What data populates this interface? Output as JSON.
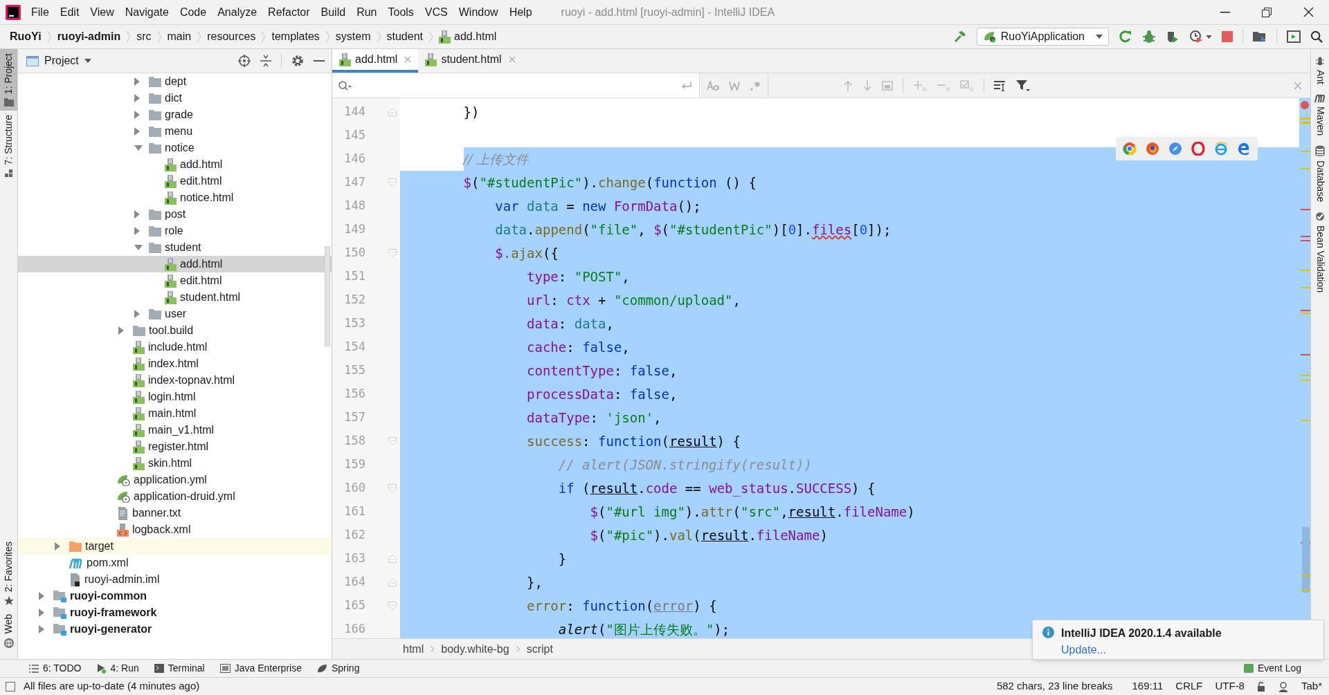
{
  "window": {
    "title": "ruoyi - add.html [ruoyi-admin] - IntelliJ IDEA"
  },
  "main_menu": [
    "File",
    "Edit",
    "View",
    "Navigate",
    "Code",
    "Analyze",
    "Refactor",
    "Build",
    "Run",
    "Tools",
    "VCS",
    "Window",
    "Help"
  ],
  "nav_path": [
    {
      "label": "RuoYi",
      "kind": "project"
    },
    {
      "label": "ruoyi-admin",
      "kind": "module"
    },
    {
      "label": "src",
      "kind": "folder"
    },
    {
      "label": "main",
      "kind": "folder"
    },
    {
      "label": "resources",
      "kind": "folder"
    },
    {
      "label": "templates",
      "kind": "folder"
    },
    {
      "label": "system",
      "kind": "folder"
    },
    {
      "label": "student",
      "kind": "folder"
    },
    {
      "label": "add.html",
      "kind": "html"
    }
  ],
  "run_config": "RuoYiApplication",
  "left_strip": [
    {
      "label": "1: Project",
      "kind": "project",
      "selected": true
    },
    {
      "label": "7: Structure",
      "kind": "structure",
      "selected": false
    },
    {
      "label": "2: Favorites",
      "kind": "favorites",
      "selected": false
    },
    {
      "label": "Web",
      "kind": "web",
      "selected": false
    }
  ],
  "project_panel": {
    "title": "Project"
  },
  "tree": [
    {
      "kind": "group",
      "children": [
        {
          "kind": "group",
          "children": [
            {
              "kind": "group",
              "children": [
                {
                  "kind": "group",
                  "children": [
                    {
                      "kind": "group",
                      "children": [
                        {
                          "kind": "group",
                          "children": [
                            {
                              "label": "dept",
                              "kind": "folder",
                              "expanded": false,
                              "selected": false
                            },
                            {
                              "label": "dict",
                              "kind": "folder",
                              "expanded": false,
                              "selected": false
                            },
                            {
                              "label": "grade",
                              "kind": "folder",
                              "expanded": false,
                              "selected": false
                            },
                            {
                              "label": "menu",
                              "kind": "folder",
                              "expanded": false,
                              "selected": false
                            },
                            {
                              "label": "notice",
                              "kind": "folder",
                              "expanded": true,
                              "selected": false,
                              "children": [
                                {
                                  "label": "add.html",
                                  "kind": "html",
                                  "selected": false
                                },
                                {
                                  "label": "edit.html",
                                  "kind": "html",
                                  "selected": false
                                },
                                {
                                  "label": "notice.html",
                                  "kind": "html",
                                  "selected": false
                                }
                              ]
                            },
                            {
                              "label": "post",
                              "kind": "folder",
                              "expanded": false,
                              "selected": false
                            },
                            {
                              "label": "role",
                              "kind": "folder",
                              "expanded": false,
                              "selected": false
                            },
                            {
                              "label": "student",
                              "kind": "folder",
                              "expanded": true,
                              "selected": false,
                              "children": [
                                {
                                  "label": "add.html",
                                  "kind": "html",
                                  "selected": true
                                },
                                {
                                  "label": "edit.html",
                                  "kind": "html",
                                  "selected": false
                                },
                                {
                                  "label": "student.html",
                                  "kind": "html",
                                  "selected": false
                                }
                              ]
                            },
                            {
                              "label": "user",
                              "kind": "folder",
                              "expanded": false,
                              "selected": false
                            }
                          ]
                        },
                        {
                          "label": "tool.build",
                          "kind": "folder",
                          "expanded": false,
                          "selected": false
                        },
                        {
                          "label": "include.html",
                          "kind": "html",
                          "selected": false
                        },
                        {
                          "label": "index.html",
                          "kind": "html",
                          "selected": false
                        },
                        {
                          "label": "index-topnav.html",
                          "kind": "html",
                          "selected": false
                        },
                        {
                          "label": "login.html",
                          "kind": "html",
                          "selected": false
                        },
                        {
                          "label": "main.html",
                          "kind": "html",
                          "selected": false
                        },
                        {
                          "label": "main_v1.html",
                          "kind": "html",
                          "selected": false
                        },
                        {
                          "label": "register.html",
                          "kind": "html",
                          "selected": false
                        },
                        {
                          "label": "skin.html",
                          "kind": "html",
                          "selected": false
                        }
                      ]
                    },
                    {
                      "label": "application.yml",
                      "kind": "yml",
                      "selected": false
                    },
                    {
                      "label": "application-druid.yml",
                      "kind": "yml",
                      "selected": false
                    },
                    {
                      "label": "banner.txt",
                      "kind": "txt",
                      "selected": false
                    },
                    {
                      "label": "logback.xml",
                      "kind": "xml",
                      "selected": false
                    }
                  ]
                }
              ]
            }
          ]
        },
        {
          "label": "target",
          "kind": "excluded",
          "expanded": false,
          "selected": false
        },
        {
          "label": "pom.xml",
          "kind": "maven",
          "selected": false
        },
        {
          "label": "ruoyi-admin.iml",
          "kind": "iml",
          "selected": false
        }
      ]
    },
    {
      "label": "ruoyi-common",
      "kind": "module",
      "expanded": false,
      "selected": false
    },
    {
      "label": "ruoyi-framework",
      "kind": "module",
      "expanded": false,
      "selected": false
    },
    {
      "label": "ruoyi-generator",
      "kind": "module",
      "expanded": false,
      "selected": false
    }
  ],
  "editor_tabs": [
    {
      "label": "add.html",
      "selected": true
    },
    {
      "label": "student.html",
      "selected": false
    }
  ],
  "code_lines": [
    {
      "number": "144",
      "selected": false,
      "fold_start": false,
      "fold_end": true,
      "tokens": [
        {
          "kind": "plain",
          "text": "        })"
        }
      ]
    },
    {
      "number": "145",
      "selected": false,
      "fold_start": false,
      "fold_end": false
    },
    {
      "number": "146",
      "selected": true,
      "fold_start": false,
      "fold_end": false,
      "tokens": [
        {
          "kind": "comment",
          "text": "        // 上传文件"
        }
      ]
    },
    {
      "number": "147",
      "selected": true,
      "fold_start": true,
      "fold_end": false,
      "tokens": [
        {
          "kind": "prop",
          "text": "        $"
        },
        {
          "kind": "plain",
          "text": "("
        },
        {
          "kind": "string",
          "text": "\"#studentPic\""
        },
        {
          "kind": "plain",
          "text": ")."
        },
        {
          "kind": "method",
          "text": "change"
        },
        {
          "kind": "plain",
          "text": "("
        },
        {
          "kind": "keyword",
          "text": "function"
        },
        {
          "kind": "plain",
          "text": " () {"
        }
      ]
    },
    {
      "number": "148",
      "selected": true,
      "fold_start": false,
      "fold_end": false,
      "tokens": [
        {
          "kind": "keyword",
          "text": "            var"
        },
        {
          "kind": "local",
          "text": " data"
        },
        {
          "kind": "plain",
          "text": " = "
        },
        {
          "kind": "keyword",
          "text": "new"
        },
        {
          "kind": "prop",
          "text": " FormData"
        },
        {
          "kind": "plain",
          "text": "();"
        }
      ]
    },
    {
      "number": "149",
      "selected": true,
      "fold_start": false,
      "fold_end": false,
      "tokens": [
        {
          "kind": "local",
          "text": "            data"
        },
        {
          "kind": "plain",
          "text": "."
        },
        {
          "kind": "method",
          "text": "append"
        },
        {
          "kind": "plain",
          "text": "("
        },
        {
          "kind": "string",
          "text": "\"file\""
        },
        {
          "kind": "plain",
          "text": ", "
        },
        {
          "kind": "prop",
          "text": "$"
        },
        {
          "kind": "plain",
          "text": "("
        },
        {
          "kind": "string",
          "text": "\"#studentPic\""
        },
        {
          "kind": "plain",
          "text": ")["
        },
        {
          "kind": "number",
          "text": "0"
        },
        {
          "kind": "plain",
          "text": "]."
        },
        {
          "kind": "warn",
          "text": "files"
        },
        {
          "kind": "plain",
          "text": "["
        },
        {
          "kind": "number",
          "text": "0"
        },
        {
          "kind": "plain",
          "text": "]);"
        }
      ]
    },
    {
      "number": "150",
      "selected": true,
      "fold_start": true,
      "fold_end": false,
      "tokens": [
        {
          "kind": "prop",
          "text": "            $"
        },
        {
          "kind": "method",
          "text": ".ajax"
        },
        {
          "kind": "plain",
          "text": "({"
        }
      ]
    },
    {
      "number": "151",
      "selected": true,
      "fold_start": false,
      "fold_end": false,
      "tokens": [
        {
          "kind": "prop",
          "text": "                type"
        },
        {
          "kind": "plain",
          "text": ": "
        },
        {
          "kind": "string",
          "text": "\"POST\""
        },
        {
          "kind": "plain",
          "text": ","
        }
      ]
    },
    {
      "number": "152",
      "selected": true,
      "fold_start": false,
      "fold_end": false,
      "tokens": [
        {
          "kind": "prop",
          "text": "                url"
        },
        {
          "kind": "plain",
          "text": ": "
        },
        {
          "kind": "prop",
          "text": "ctx"
        },
        {
          "kind": "plain",
          "text": " + "
        },
        {
          "kind": "string",
          "text": "\"common/upload\""
        },
        {
          "kind": "plain",
          "text": ","
        }
      ]
    },
    {
      "number": "153",
      "selected": true,
      "fold_start": false,
      "fold_end": false,
      "tokens": [
        {
          "kind": "prop",
          "text": "                data"
        },
        {
          "kind": "plain",
          "text": ": "
        },
        {
          "kind": "local",
          "text": "data"
        },
        {
          "kind": "plain",
          "text": ","
        }
      ]
    },
    {
      "number": "154",
      "selected": true,
      "fold_start": false,
      "fold_end": false,
      "tokens": [
        {
          "kind": "prop",
          "text": "                cache"
        },
        {
          "kind": "plain",
          "text": ": "
        },
        {
          "kind": "keyword",
          "text": "false"
        },
        {
          "kind": "plain",
          "text": ","
        }
      ]
    },
    {
      "number": "155",
      "selected": true,
      "fold_start": false,
      "fold_end": false,
      "tokens": [
        {
          "kind": "prop",
          "text": "                contentType"
        },
        {
          "kind": "plain",
          "text": ": "
        },
        {
          "kind": "keyword",
          "text": "false"
        },
        {
          "kind": "plain",
          "text": ","
        }
      ]
    },
    {
      "number": "156",
      "selected": true,
      "fold_start": false,
      "fold_end": false,
      "tokens": [
        {
          "kind": "prop",
          "text": "                processData"
        },
        {
          "kind": "plain",
          "text": ": "
        },
        {
          "kind": "keyword",
          "text": "false"
        },
        {
          "kind": "plain",
          "text": ","
        }
      ]
    },
    {
      "number": "157",
      "selected": true,
      "fold_start": false,
      "fold_end": false,
      "tokens": [
        {
          "kind": "prop",
          "text": "                dataType"
        },
        {
          "kind": "plain",
          "text": ": "
        },
        {
          "kind": "string",
          "text": "'json'"
        },
        {
          "kind": "plain",
          "text": ","
        }
      ]
    },
    {
      "number": "158",
      "selected": true,
      "fold_start": true,
      "fold_end": false,
      "tokens": [
        {
          "kind": "method",
          "text": "                success"
        },
        {
          "kind": "plain",
          "text": ": "
        },
        {
          "kind": "keyword",
          "text": "function"
        },
        {
          "kind": "plain",
          "text": "("
        },
        {
          "kind": "param",
          "text": "result"
        },
        {
          "kind": "plain",
          "text": ") {"
        }
      ]
    },
    {
      "number": "159",
      "selected": true,
      "fold_start": false,
      "fold_end": false,
      "tokens": [
        {
          "kind": "comment",
          "text": "                    // alert(JSON.stringify(result))"
        }
      ]
    },
    {
      "number": "160",
      "selected": true,
      "fold_start": true,
      "fold_end": false,
      "tokens": [
        {
          "kind": "keyword",
          "text": "                    if"
        },
        {
          "kind": "plain",
          "text": " ("
        },
        {
          "kind": "param",
          "text": "result"
        },
        {
          "kind": "plain",
          "text": "."
        },
        {
          "kind": "prop",
          "text": "code"
        },
        {
          "kind": "plain",
          "text": " == "
        },
        {
          "kind": "prop",
          "text": "web_status"
        },
        {
          "kind": "plain",
          "text": "."
        },
        {
          "kind": "prop",
          "text": "SUCCESS"
        },
        {
          "kind": "plain",
          "text": ") {"
        }
      ]
    },
    {
      "number": "161",
      "selected": true,
      "fold_start": false,
      "fold_end": false,
      "tokens": [
        {
          "kind": "prop",
          "text": "                        $"
        },
        {
          "kind": "plain",
          "text": "("
        },
        {
          "kind": "string",
          "text": "\"#url img\""
        },
        {
          "kind": "plain",
          "text": ")."
        },
        {
          "kind": "method",
          "text": "attr"
        },
        {
          "kind": "plain",
          "text": "("
        },
        {
          "kind": "string",
          "text": "\"src\""
        },
        {
          "kind": "plain",
          "text": ","
        },
        {
          "kind": "param",
          "text": "result"
        },
        {
          "kind": "plain",
          "text": "."
        },
        {
          "kind": "prop",
          "text": "fileName"
        },
        {
          "kind": "plain",
          "text": ")"
        }
      ]
    },
    {
      "number": "162",
      "selected": true,
      "fold_start": false,
      "fold_end": false,
      "tokens": [
        {
          "kind": "prop",
          "text": "                        $"
        },
        {
          "kind": "plain",
          "text": "("
        },
        {
          "kind": "string",
          "text": "\"#pic\""
        },
        {
          "kind": "plain",
          "text": ")."
        },
        {
          "kind": "method",
          "text": "val"
        },
        {
          "kind": "plain",
          "text": "("
        },
        {
          "kind": "param",
          "text": "result"
        },
        {
          "kind": "plain",
          "text": "."
        },
        {
          "kind": "prop",
          "text": "fileName"
        },
        {
          "kind": "plain",
          "text": ")"
        }
      ]
    },
    {
      "number": "163",
      "selected": true,
      "fold_start": false,
      "fold_end": true,
      "tokens": [
        {
          "kind": "plain",
          "text": "                    }"
        }
      ]
    },
    {
      "number": "164",
      "selected": true,
      "fold_start": false,
      "fold_end": true,
      "tokens": [
        {
          "kind": "plain",
          "text": "                },"
        }
      ]
    },
    {
      "number": "165",
      "selected": true,
      "fold_start": true,
      "fold_end": false,
      "tokens": [
        {
          "kind": "method",
          "text": "                error"
        },
        {
          "kind": "plain",
          "text": ": "
        },
        {
          "kind": "keyword",
          "text": "function"
        },
        {
          "kind": "plain",
          "text": "("
        },
        {
          "kind": "unused",
          "text": "error"
        },
        {
          "kind": "plain",
          "text": ") {"
        }
      ]
    },
    {
      "number": "166",
      "selected": true,
      "fold_start": false,
      "fold_end": false,
      "tokens": [
        {
          "kind": "call",
          "text": "                    alert"
        },
        {
          "kind": "plain",
          "text": "("
        },
        {
          "kind": "string",
          "text": "\"图片上传失败。\""
        },
        {
          "kind": "plain",
          "text": ");"
        }
      ]
    }
  ],
  "editor_breadcrumb": [
    "html",
    "body.white-bg",
    "script"
  ],
  "right_strip": [
    {
      "label": "Ant",
      "kind": "ant"
    },
    {
      "label": "Maven",
      "kind": "maven"
    },
    {
      "label": "Database",
      "kind": "database"
    },
    {
      "label": "Bean Validation",
      "kind": "bean"
    }
  ],
  "tool_windows": [
    {
      "label": "6: TODO",
      "kind": "todo"
    },
    {
      "label": "4: Run",
      "kind": "run"
    },
    {
      "label": "Terminal",
      "kind": "terminal"
    },
    {
      "label": "Java Enterprise",
      "kind": "enterprise"
    },
    {
      "label": "Spring",
      "kind": "spring"
    }
  ],
  "event_log": "Event Log",
  "notification": {
    "title": "IntelliJ IDEA 2020.1.4 available",
    "link": "Update..."
  },
  "status": {
    "message": "All files are up-to-date (4 minutes ago)",
    "selection_info": "582 chars, 23 line breaks",
    "position": "169:11",
    "line_separator": "CRLF",
    "encoding": "UTF-8",
    "indent": "Tab*"
  }
}
